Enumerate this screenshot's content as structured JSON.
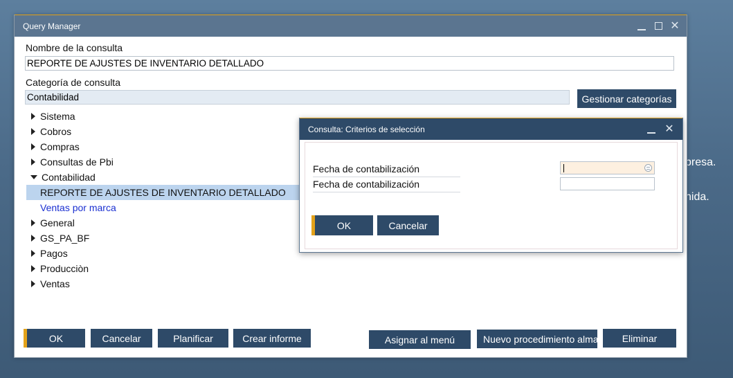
{
  "background": {
    "text_1": "presa.",
    "text_2": "nida."
  },
  "window": {
    "title": "Query Manager",
    "query_name_label": "Nombre de la consulta",
    "query_name_value": "REPORTE DE AJUSTES DE INVENTARIO DETALLADO",
    "category_label": "Categoría de consulta",
    "category_value": "Contabilidad",
    "manage_categories_button": "Gestionar categorías"
  },
  "tree": [
    {
      "label": "Sistema",
      "level": 0,
      "expanded": false
    },
    {
      "label": "Cobros",
      "level": 0,
      "expanded": false
    },
    {
      "label": "Compras",
      "level": 0,
      "expanded": false
    },
    {
      "label": "Consultas de Pbi",
      "level": 0,
      "expanded": false
    },
    {
      "label": "Contabilidad",
      "level": 0,
      "expanded": true
    },
    {
      "label": "REPORTE DE AJUSTES DE INVENTARIO DETALLADO",
      "level": 1,
      "selected": true
    },
    {
      "label": "Ventas por marca",
      "level": 1,
      "link": true
    },
    {
      "label": "General",
      "level": 0,
      "expanded": false
    },
    {
      "label": "GS_PA_BF",
      "level": 0,
      "expanded": false
    },
    {
      "label": "Pagos",
      "level": 0,
      "expanded": false
    },
    {
      "label": "Producciòn",
      "level": 0,
      "expanded": false
    },
    {
      "label": "Ventas",
      "level": 0,
      "expanded": false
    }
  ],
  "bottom_buttons": {
    "ok": "OK",
    "cancel": "Cancelar",
    "schedule": "Planificar",
    "create_report": "Crear informe",
    "assign_menu": "Asignar al menú",
    "new_procedure": "Nuevo procedimiento almacenado",
    "delete": "Eliminar"
  },
  "dialog": {
    "title": "Consulta: Criterios de selección",
    "criteria": [
      {
        "label": "Fecha de contabilización",
        "value": ""
      },
      {
        "label": "Fecha de contabilización",
        "value": ""
      }
    ],
    "ok": "OK",
    "cancel": "Cancelar"
  },
  "colors": {
    "accent": "#e3a21a",
    "button": "#2e4a68",
    "titlebar": "#5b7590",
    "selection": "#bcd4ee",
    "link": "#1a2fd1"
  }
}
